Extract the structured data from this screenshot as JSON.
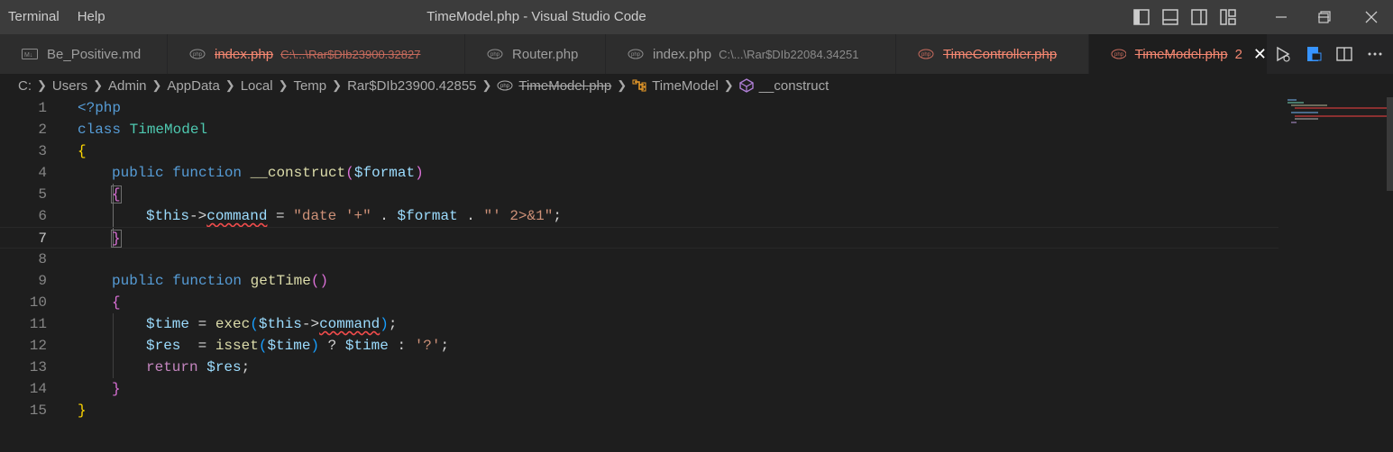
{
  "menu": [
    "Terminal",
    "Help"
  ],
  "window_title": "TimeModel.php - Visual Studio Code",
  "tabs": [
    {
      "label": "Be_Positive.md",
      "path": "",
      "error": false,
      "icon": "markdown-file-icon"
    },
    {
      "label": "index.php",
      "path": "C:\\...\\Rar$DIb23900.32827",
      "error": true,
      "icon": "php-file-icon"
    },
    {
      "label": "Router.php",
      "path": "",
      "error": false,
      "icon": "php-file-icon"
    },
    {
      "label": "index.php",
      "path": "C:\\...\\Rar$DIb22084.34251",
      "error": false,
      "icon": "php-file-icon"
    },
    {
      "label": "TimeController.php",
      "path": "",
      "error": true,
      "icon": "php-file-icon"
    },
    {
      "label": "TimeModel.php",
      "path": "",
      "error": true,
      "active": true,
      "problem_count": "2",
      "close": "✕",
      "icon": "php-file-icon"
    }
  ],
  "breadcrumb": [
    "C:",
    "Users",
    "Admin",
    "AppData",
    "Local",
    "Temp",
    "Rar$DIb23900.42855",
    "TimeModel.php",
    "TimeModel",
    "__construct"
  ],
  "line_numbers": [
    "1",
    "2",
    "3",
    "4",
    "5",
    "6",
    "7",
    "8",
    "9",
    "10",
    "11",
    "12",
    "13",
    "14",
    "15"
  ],
  "current_line": 7,
  "code": {
    "l1": "<?php",
    "l2_kw": "class",
    "l2_name": "TimeModel",
    "l3": "{",
    "l4_mod": "public",
    "l4_kw": "function",
    "l4_fn": "__construct",
    "l4_open": "(",
    "l4_param": "$format",
    "l4_close": ")",
    "l5": "{",
    "l6_this": "$this",
    "l6_arrow": "->",
    "l6_prop": "command",
    "l6_eq": " = ",
    "l6_str1": "\"date '+\"",
    "l6_dot1": " . ",
    "l6_var": "$format",
    "l6_dot2": " . ",
    "l6_str2": "\"' 2>&1\"",
    "l6_semi": ";",
    "l7": "}",
    "l9_mod": "public",
    "l9_kw": "function",
    "l9_fn": "getTime",
    "l9_parens": "()",
    "l10": "{",
    "l11_var": "$time",
    "l11_eq": " = ",
    "l11_fn": "exec",
    "l11_open": "(",
    "l11_this": "$this",
    "l11_arrow": "->",
    "l11_prop": "command",
    "l11_close": ")",
    "l11_semi": ";",
    "l12_var": "$res",
    "l12_eq": "  = ",
    "l12_fn": "isset",
    "l12_open": "(",
    "l12_arg": "$time",
    "l12_close": ")",
    "l12_q": " ? ",
    "l12_var2": "$time",
    "l12_colon": " : ",
    "l12_str": "'?'",
    "l12_semi": ";",
    "l13_kw": "return",
    "l13_var": "$res",
    "l13_semi": ";",
    "l14": "}",
    "l15": "}"
  },
  "colors": {
    "error": "#f48771",
    "keyword": "#569cd6",
    "class": "#4ec9b0",
    "function": "#dcdcaa",
    "variable": "#9cdcfe",
    "string": "#ce9178",
    "bracket_gold": "#ffd700",
    "bracket_purple": "#da70d6",
    "bracket_blue": "#179fff"
  }
}
